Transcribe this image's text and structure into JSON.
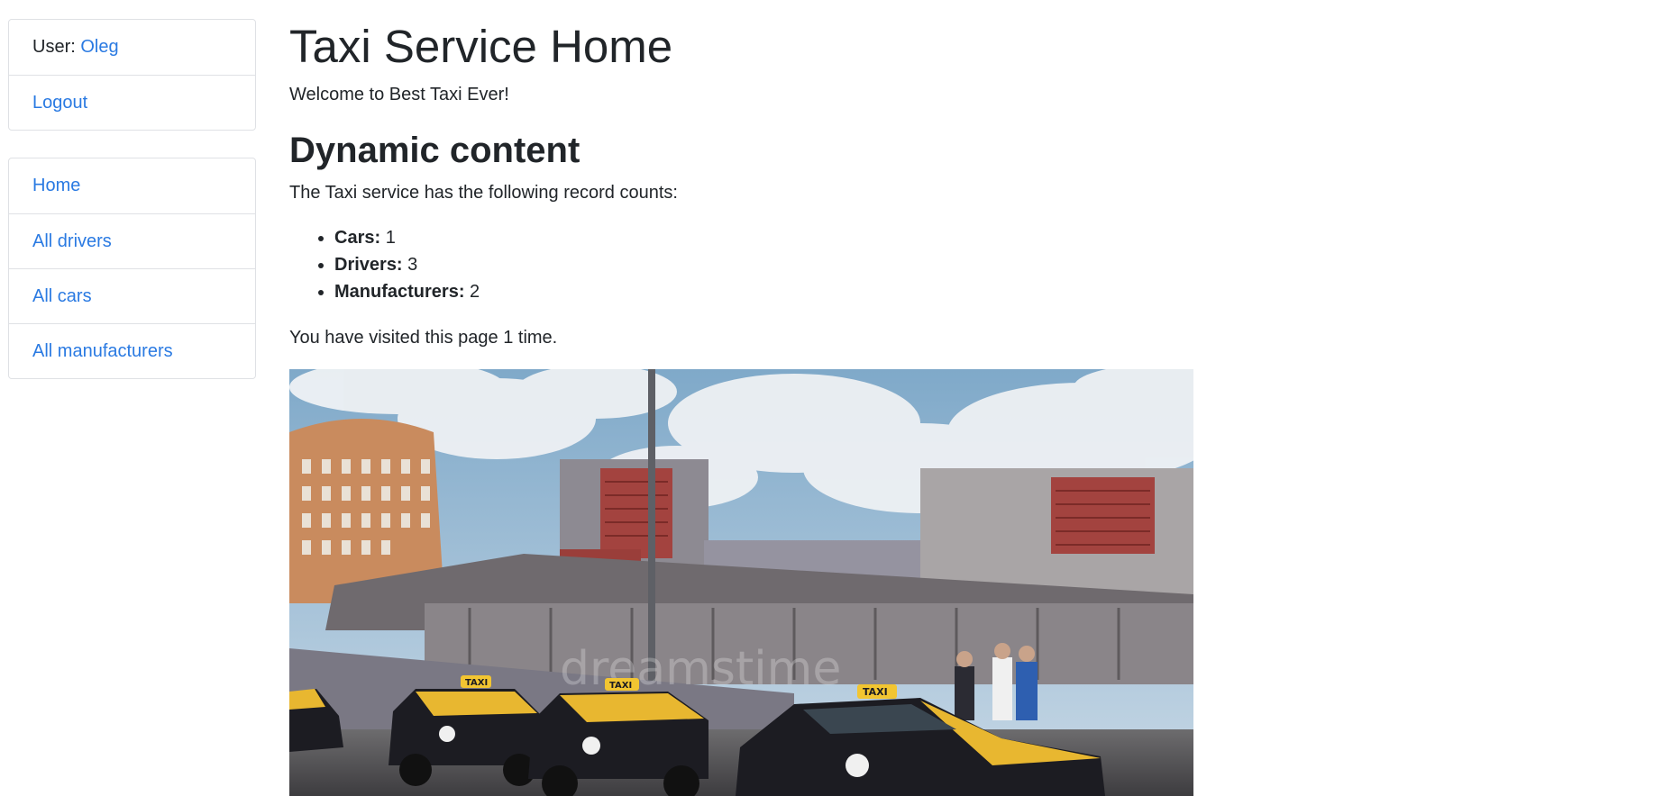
{
  "sidebar": {
    "user_prefix": "User: ",
    "user_name": "Oleg",
    "logout": "Logout",
    "nav": [
      {
        "label": "Home"
      },
      {
        "label": "All drivers"
      },
      {
        "label": "All cars"
      },
      {
        "label": "All manufacturers"
      }
    ]
  },
  "main": {
    "title": "Taxi Service Home",
    "welcome": "Welcome to Best Taxi Ever!",
    "section_title": "Dynamic content",
    "counts_intro": "The Taxi service has the following record counts:",
    "counts": [
      {
        "label": "Cars:",
        "value": "1"
      },
      {
        "label": "Drivers:",
        "value": "3"
      },
      {
        "label": "Manufacturers:",
        "value": "2"
      }
    ],
    "visited": "You have visited this page 1 time.",
    "image": {
      "subject": "taxi rank with black and yellow taxis in front of a station building",
      "watermark": "dreamstime",
      "taxi_sign": "TAXI"
    }
  },
  "colors": {
    "link": "#2a7ae2",
    "text": "#212529",
    "border": "#dfe1e5",
    "taxi_yellow": "#e8b730",
    "taxi_black": "#1c1c22"
  }
}
